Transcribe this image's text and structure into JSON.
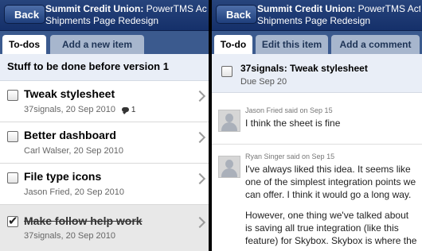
{
  "app": {
    "back_label": "Back",
    "org": "Summit Credit Union:",
    "project_line1": "PowerTMS Active",
    "project_line2": "Shipments Page Redesign"
  },
  "left": {
    "tabs": [
      {
        "label": "To-dos"
      },
      {
        "label": "Add a new item"
      }
    ],
    "list_title": "Stuff to be done before version 1",
    "items": [
      {
        "title": "Tweak stylesheet",
        "meta": "37signals, 20 Sep 2010",
        "comment_count": "1",
        "done": false
      },
      {
        "title": "Better dashboard",
        "meta": "Carl Walser, 20 Sep 2010",
        "done": false
      },
      {
        "title": "File type icons",
        "meta": "Jason Fried, 20 Sep 2010",
        "done": false
      },
      {
        "title": "Make follow help work",
        "meta": "37signals, 20 Sep 2010",
        "done": true
      }
    ]
  },
  "right": {
    "tabs": [
      {
        "label": "To-do"
      },
      {
        "label": "Edit this item"
      },
      {
        "label": "Add a comment"
      }
    ],
    "todo_title": "37signals: Tweak stylesheet",
    "todo_due": "Due Sep 20",
    "comments": [
      {
        "author": "Jason Fried said on Sep 15",
        "paragraphs": [
          "I think the sheet is fine"
        ]
      },
      {
        "author": "Ryan Singer said on Sep 15",
        "paragraphs": [
          "I've always liked this idea. It seems like one of the simplest integration points we can offer. I think it would go a long way.",
          "However, one thing we've talked about is saving all true integration (like this feature) for Skybox. Skybox is where the"
        ]
      }
    ]
  },
  "colors": {
    "navbar": "#1b3670",
    "tabstrip": "#3b5a8e",
    "heading_bg": "#e9eef7"
  }
}
